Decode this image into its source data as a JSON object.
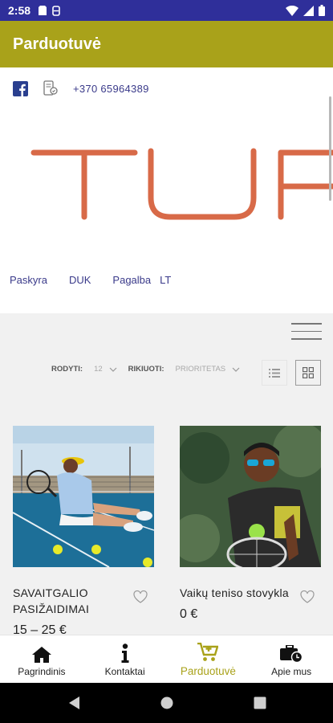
{
  "status": {
    "time": "2:58"
  },
  "app": {
    "title": "Parduotuvė"
  },
  "header": {
    "phone": "+370 65964389",
    "nav": [
      "Paskyra",
      "DUK",
      "Pagalba",
      "LT"
    ]
  },
  "toolbar": {
    "show_label": "RODYTI:",
    "show_value": "12",
    "sort_label": "RIKIUOTI:",
    "sort_value": "PRIORITETAS"
  },
  "products": [
    {
      "name": "SAVAITGALIO PASIŽAIDIMAI",
      "price": "15 – 25 €"
    },
    {
      "name": "Vaikų teniso stovykla",
      "price": "0 €"
    }
  ],
  "bottom_nav": [
    {
      "label": "Pagrindinis",
      "icon": "home-icon"
    },
    {
      "label": "Kontaktai",
      "icon": "info-icon"
    },
    {
      "label": "Parduotuvė",
      "icon": "cart-icon",
      "active": true
    },
    {
      "label": "Apie mus",
      "icon": "briefcase-clock-icon"
    }
  ],
  "colors": {
    "status_bar": "#2f2f9a",
    "app_bar": "#a9a21a",
    "logo": "#d86a48",
    "link": "#3a3a8a"
  }
}
